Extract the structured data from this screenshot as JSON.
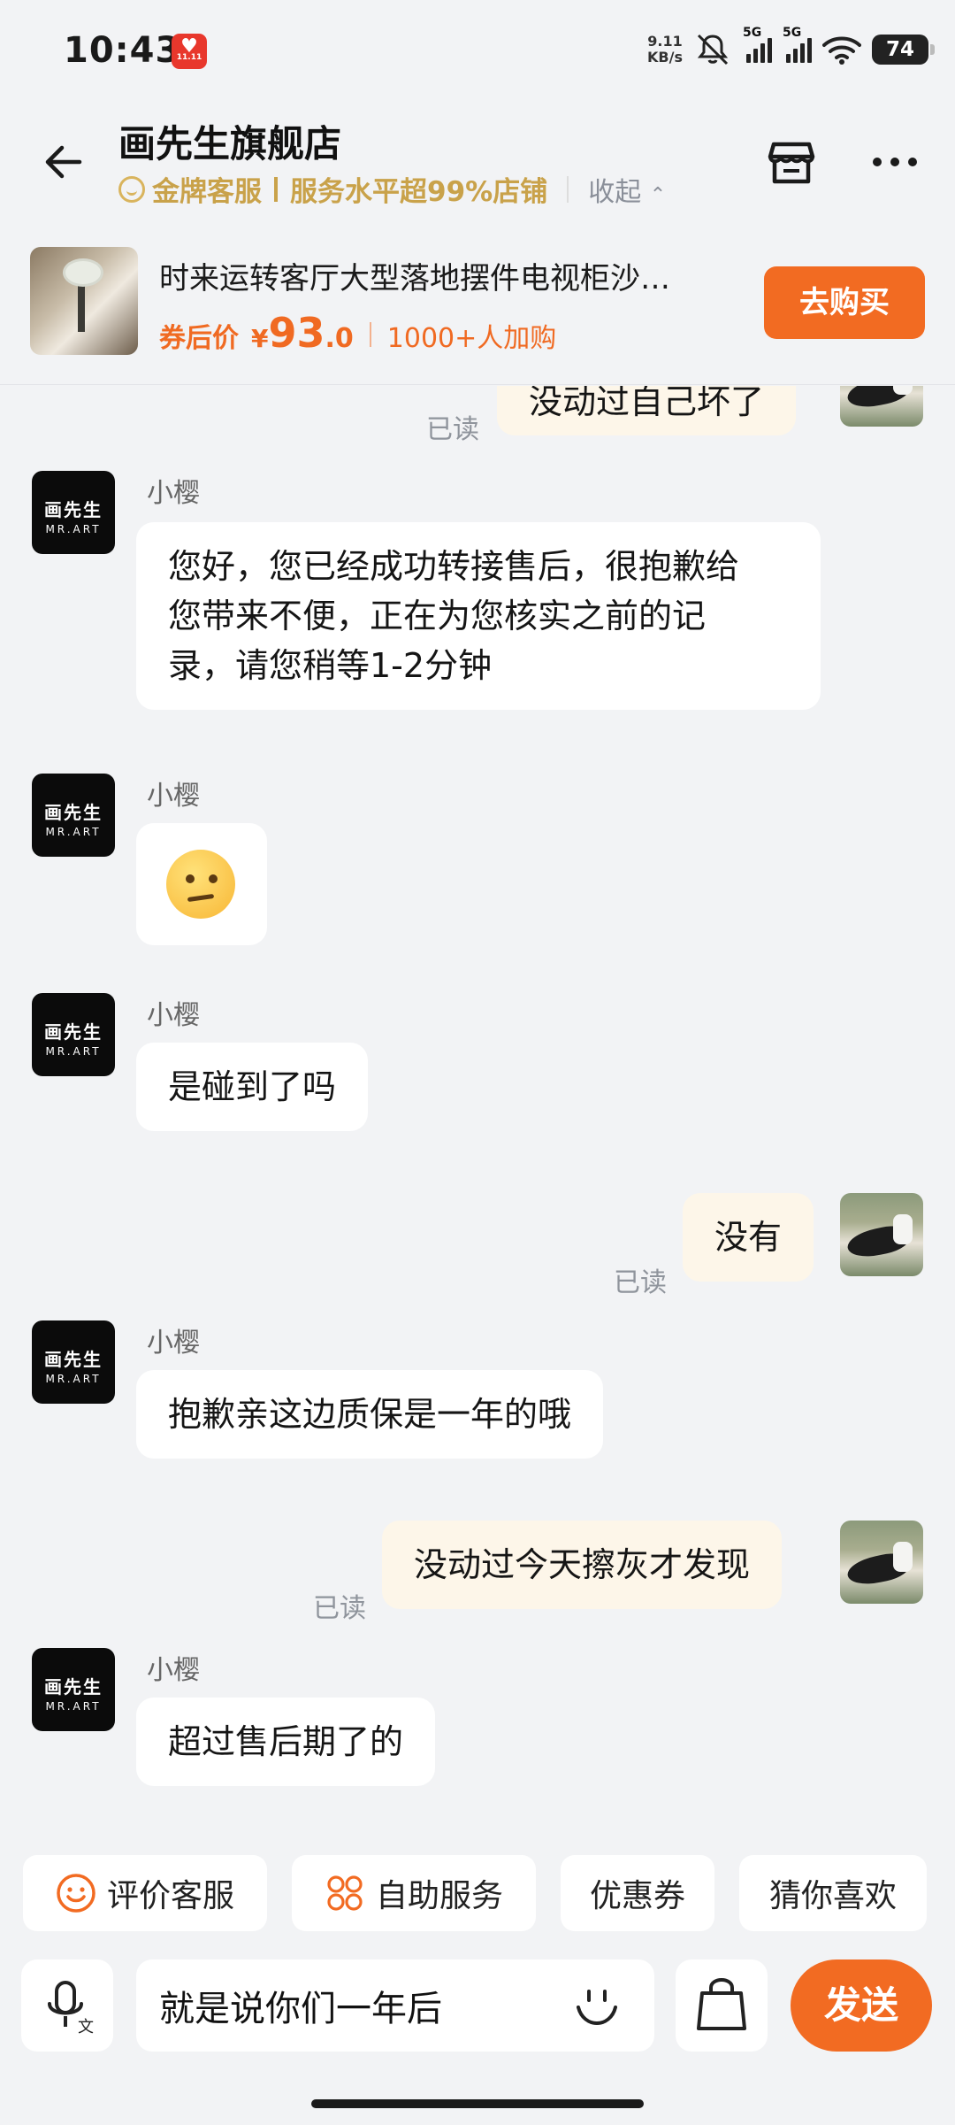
{
  "status_bar": {
    "time": "10:43",
    "app_badge": "11.11",
    "net_speed_value": "9.11",
    "net_speed_unit": "KB/s",
    "sim1": "5G",
    "sim2": "5G",
    "battery": "74"
  },
  "header": {
    "shop_name": "画先生旗舰店",
    "badge_gold": "金牌客服",
    "badge_service": "服务水平超99%店铺",
    "collapse_label": "收起"
  },
  "product": {
    "title": "时来运转客厅大型落地摆件电视柜沙…",
    "price_label": "券后价",
    "currency": "¥",
    "price_int": "93",
    "price_dec": ".0",
    "added_count": "1000+人加购",
    "buy_label": "去购买"
  },
  "chat": {
    "partial_out": {
      "text": "没动过自己坏了",
      "read": "已读"
    },
    "messages": [
      {
        "sender": "小樱",
        "text": "您好，您已经成功转接售后，很抱歉给\n您带来不便，正在为您核实之前的记\n录，请您稍等1-2分钟"
      },
      {
        "sender": "小樱",
        "emoji": "thinking-face"
      },
      {
        "sender": "小樱",
        "text": "是碰到了吗"
      },
      {
        "out": true,
        "text": "没有",
        "read": "已读"
      },
      {
        "sender": "小樱",
        "text": "抱歉亲这边质保是一年的哦"
      },
      {
        "out": true,
        "text": "没动过今天擦灰才发现",
        "read": "已读"
      },
      {
        "sender": "小樱",
        "text": "超过售后期了的"
      }
    ],
    "bot_avatar_line1": "画先生",
    "bot_avatar_line2": "MR.ART"
  },
  "quick_actions": [
    {
      "label": "评价客服",
      "icon": "smile-icon"
    },
    {
      "label": "自助服务",
      "icon": "grid-icon"
    },
    {
      "label": "优惠券"
    },
    {
      "label": "猜你喜欢"
    }
  ],
  "composer": {
    "input_value": "就是说你们一年后",
    "send_label": "发送"
  },
  "colors": {
    "accent": "#f26b22",
    "gold": "#c9a24a",
    "out_bubble": "#fdf6e9",
    "background": "#f2f3f5"
  }
}
